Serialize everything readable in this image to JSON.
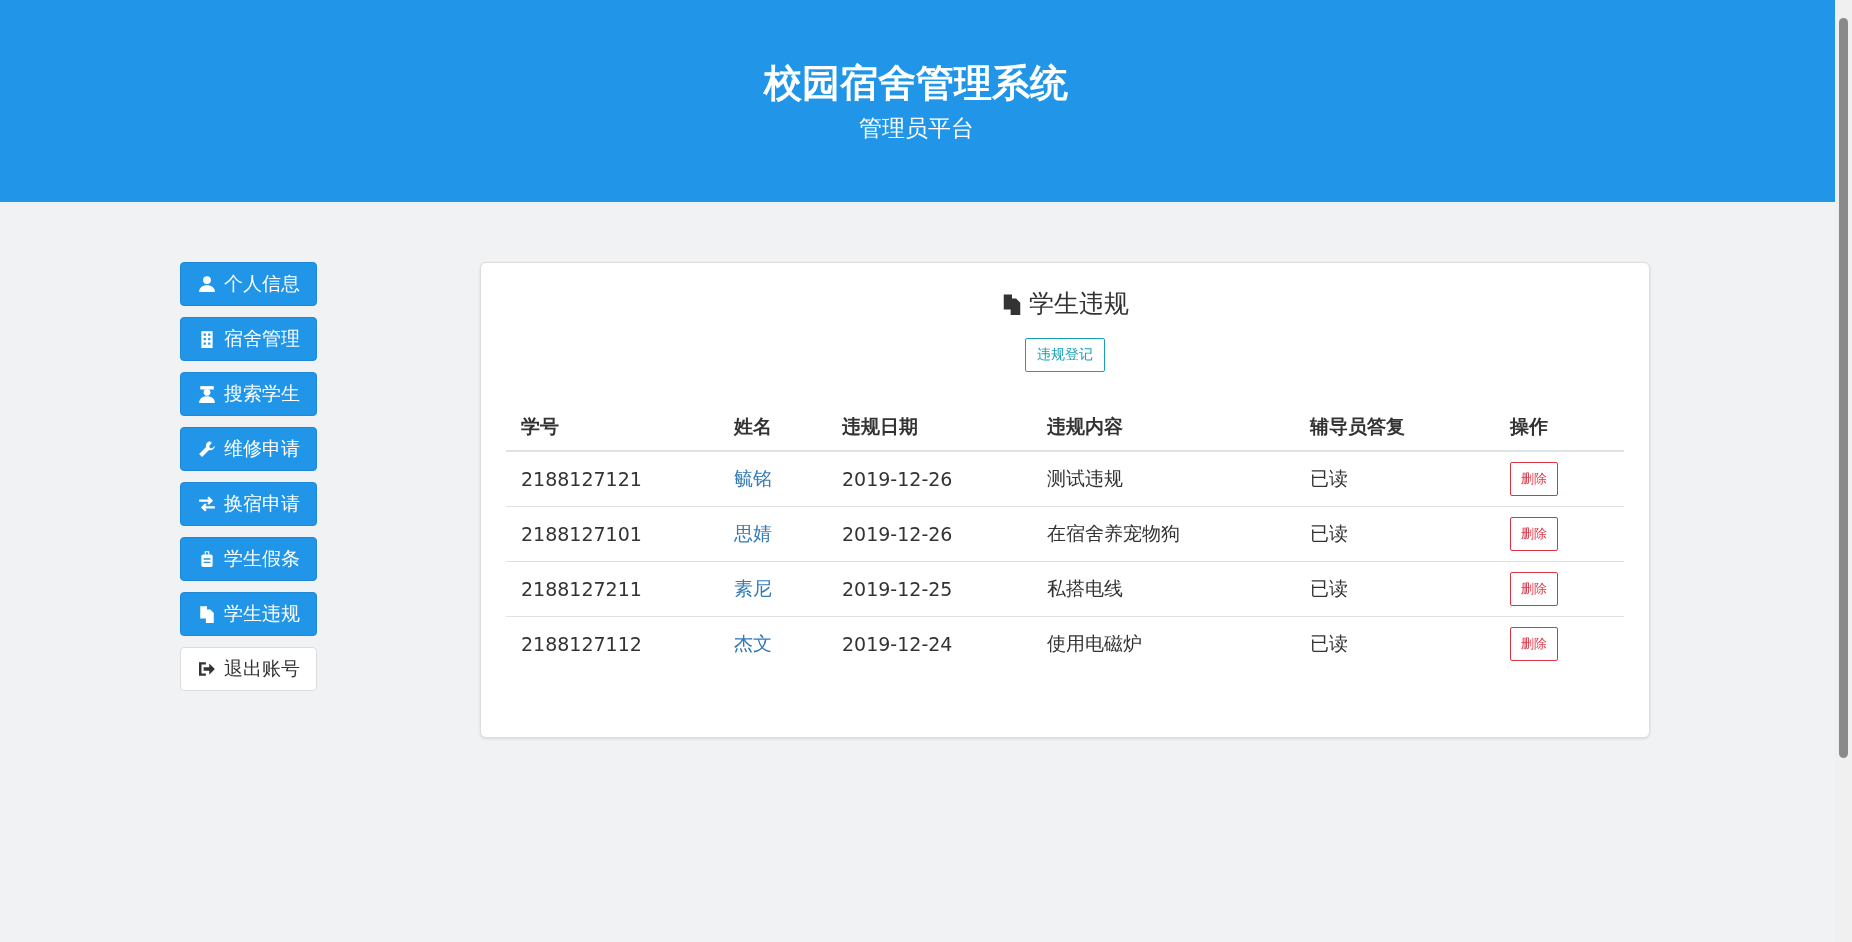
{
  "header": {
    "title": "校园宿舍管理系统",
    "subtitle": "管理员平台"
  },
  "sidebar": {
    "items": [
      {
        "label": "个人信息",
        "kind": "primary"
      },
      {
        "label": "宿舍管理",
        "kind": "primary"
      },
      {
        "label": "搜索学生",
        "kind": "primary"
      },
      {
        "label": "维修申请",
        "kind": "primary"
      },
      {
        "label": "换宿申请",
        "kind": "primary"
      },
      {
        "label": "学生假条",
        "kind": "primary"
      },
      {
        "label": "学生违规",
        "kind": "primary"
      },
      {
        "label": "退出账号",
        "kind": "default"
      }
    ]
  },
  "panel": {
    "title": "学生违规",
    "add_button": "违规登记",
    "table": {
      "columns": [
        "学号",
        "姓名",
        "违规日期",
        "违规内容",
        "辅导员答复",
        "操作"
      ],
      "rows": [
        {
          "id": "2188127121",
          "name": "毓铭",
          "date": "2019-12-26",
          "content": "测试违规",
          "reply": "已读",
          "action": "删除"
        },
        {
          "id": "2188127101",
          "name": "思婧",
          "date": "2019-12-26",
          "content": "在宿舍养宠物狗",
          "reply": "已读",
          "action": "删除"
        },
        {
          "id": "2188127211",
          "name": "素尼",
          "date": "2019-12-25",
          "content": "私搭电线",
          "reply": "已读",
          "action": "删除"
        },
        {
          "id": "2188127112",
          "name": "杰文",
          "date": "2019-12-24",
          "content": "使用电磁炉",
          "reply": "已读",
          "action": "删除"
        }
      ]
    }
  }
}
